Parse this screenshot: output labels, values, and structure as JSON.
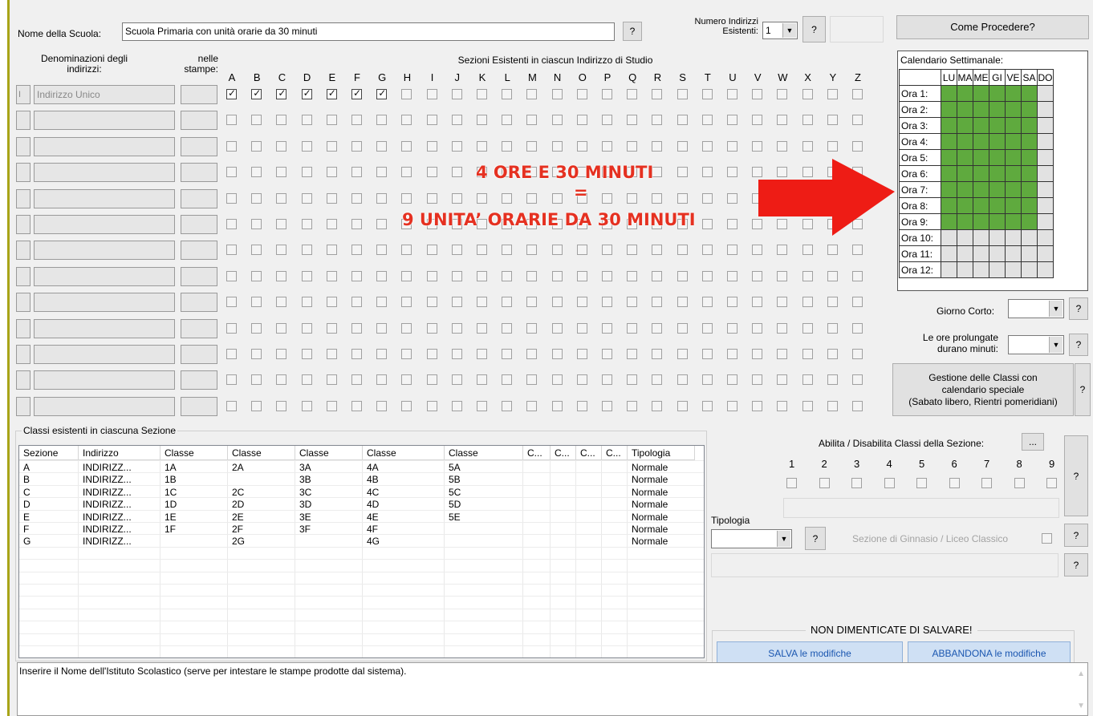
{
  "header": {
    "school_label": "Nome della Scuola:",
    "school_value": "Scuola Primaria con unità orarie da 30 minuti",
    "help": "?",
    "num_indirizzi_label_1": "Numero Indirizzi",
    "num_indirizzi_label_2": "Esistenti:",
    "num_indirizzi_value": "1",
    "come_procedere": "Come Procedere?"
  },
  "indirizzi": {
    "header_1": "Denominazioni degli",
    "header_2": "indirizzi:",
    "stampe_1": "nelle",
    "stampe_2": "stampe:",
    "sezioni_title": "Sezioni Esistenti in ciascun Indirizzo di Studio",
    "letters": [
      "A",
      "B",
      "C",
      "D",
      "E",
      "F",
      "G",
      "H",
      "I",
      "J",
      "K",
      "L",
      "M",
      "N",
      "O",
      "P",
      "Q",
      "R",
      "S",
      "T",
      "U",
      "V",
      "W",
      "X",
      "Y",
      "Z"
    ],
    "first_row_code": "I",
    "first_row_name": "Indirizzo Unico",
    "checked_first_row": 7,
    "row_count": 13
  },
  "overlay": {
    "line1": "4 ORE E 30 MINUTI",
    "line2": "=",
    "line3": "9 UNITA’ ORARIE DA 30 MINUTI",
    "arrow_color": "#ee1c15"
  },
  "calendario": {
    "title": "Calendario Settimanale:",
    "days": [
      "LU",
      "MA",
      "ME",
      "GI",
      "VE",
      "SA",
      "DO"
    ],
    "hours": [
      "Ora 1:",
      "Ora 2:",
      "Ora 3:",
      "Ora 4:",
      "Ora 5:",
      "Ora 6:",
      "Ora 7:",
      "Ora 8:",
      "Ora 9:",
      "Ora 10:",
      "Ora 11:",
      "Ora 12:"
    ],
    "active_hours": 9,
    "active_days": 6,
    "green": "#5faa3e",
    "grey": "#e2e2e2"
  },
  "right_panel": {
    "giorno_corto": "Giorno Corto:",
    "ore_prolungate_1": "Le ore prolungate",
    "ore_prolungate_2": "durano minuti:",
    "gestione_1": "Gestione delle Classi con",
    "gestione_2": "calendario speciale",
    "gestione_3": "(Sabato libero, Rientri pomeridiani)",
    "help": "?"
  },
  "classi": {
    "group_title": "Classi esistenti in ciascuna Sezione",
    "columns": [
      "Sezione",
      "Indirizzo",
      "Classe",
      "Classe",
      "Classe",
      "Classe",
      "Classe",
      "C...",
      "C...",
      "C...",
      "C...",
      "Tipologia"
    ],
    "rows": [
      [
        "A",
        "INDIRIZZ...",
        "1A",
        "2A",
        "3A",
        "4A",
        "5A",
        "",
        "",
        "",
        "",
        "Normale"
      ],
      [
        "B",
        "INDIRIZZ...",
        "1B",
        "",
        "3B",
        "4B",
        "5B",
        "",
        "",
        "",
        "",
        "Normale"
      ],
      [
        "C",
        "INDIRIZZ...",
        "1C",
        "2C",
        "3C",
        "4C",
        "5C",
        "",
        "",
        "",
        "",
        "Normale"
      ],
      [
        "D",
        "INDIRIZZ...",
        "1D",
        "2D",
        "3D",
        "4D",
        "5D",
        "",
        "",
        "",
        "",
        "Normale"
      ],
      [
        "E",
        "INDIRIZZ...",
        "1E",
        "2E",
        "3E",
        "4E",
        "5E",
        "",
        "",
        "",
        "",
        "Normale"
      ],
      [
        "F",
        "INDIRIZZ...",
        "1F",
        "2F",
        "3F",
        "4F",
        "",
        "",
        "",
        "",
        "",
        "Normale"
      ],
      [
        "G",
        "INDIRIZZ...",
        "",
        "2G",
        "",
        "4G",
        "",
        "",
        "",
        "",
        "",
        "Normale"
      ]
    ]
  },
  "abilita": {
    "label": "Abilita / Disabilita Classi della Sezione:",
    "dots": "...",
    "numbers": [
      "1",
      "2",
      "3",
      "4",
      "5",
      "6",
      "7",
      "8",
      "9"
    ],
    "tipologia": "Tipologia",
    "ginnasio": "Sezione di Ginnasio / Liceo Classico",
    "help": "?"
  },
  "salvare": {
    "title": "NON DIMENTICATE DI SALVARE!",
    "salva": "SALVA le modifiche",
    "abbandona": "ABBANDONA le modifiche"
  },
  "status": {
    "text": "Inserire il Nome dell'Istituto Scolastico (serve per intestare le stampe prodotte dal sistema)."
  }
}
